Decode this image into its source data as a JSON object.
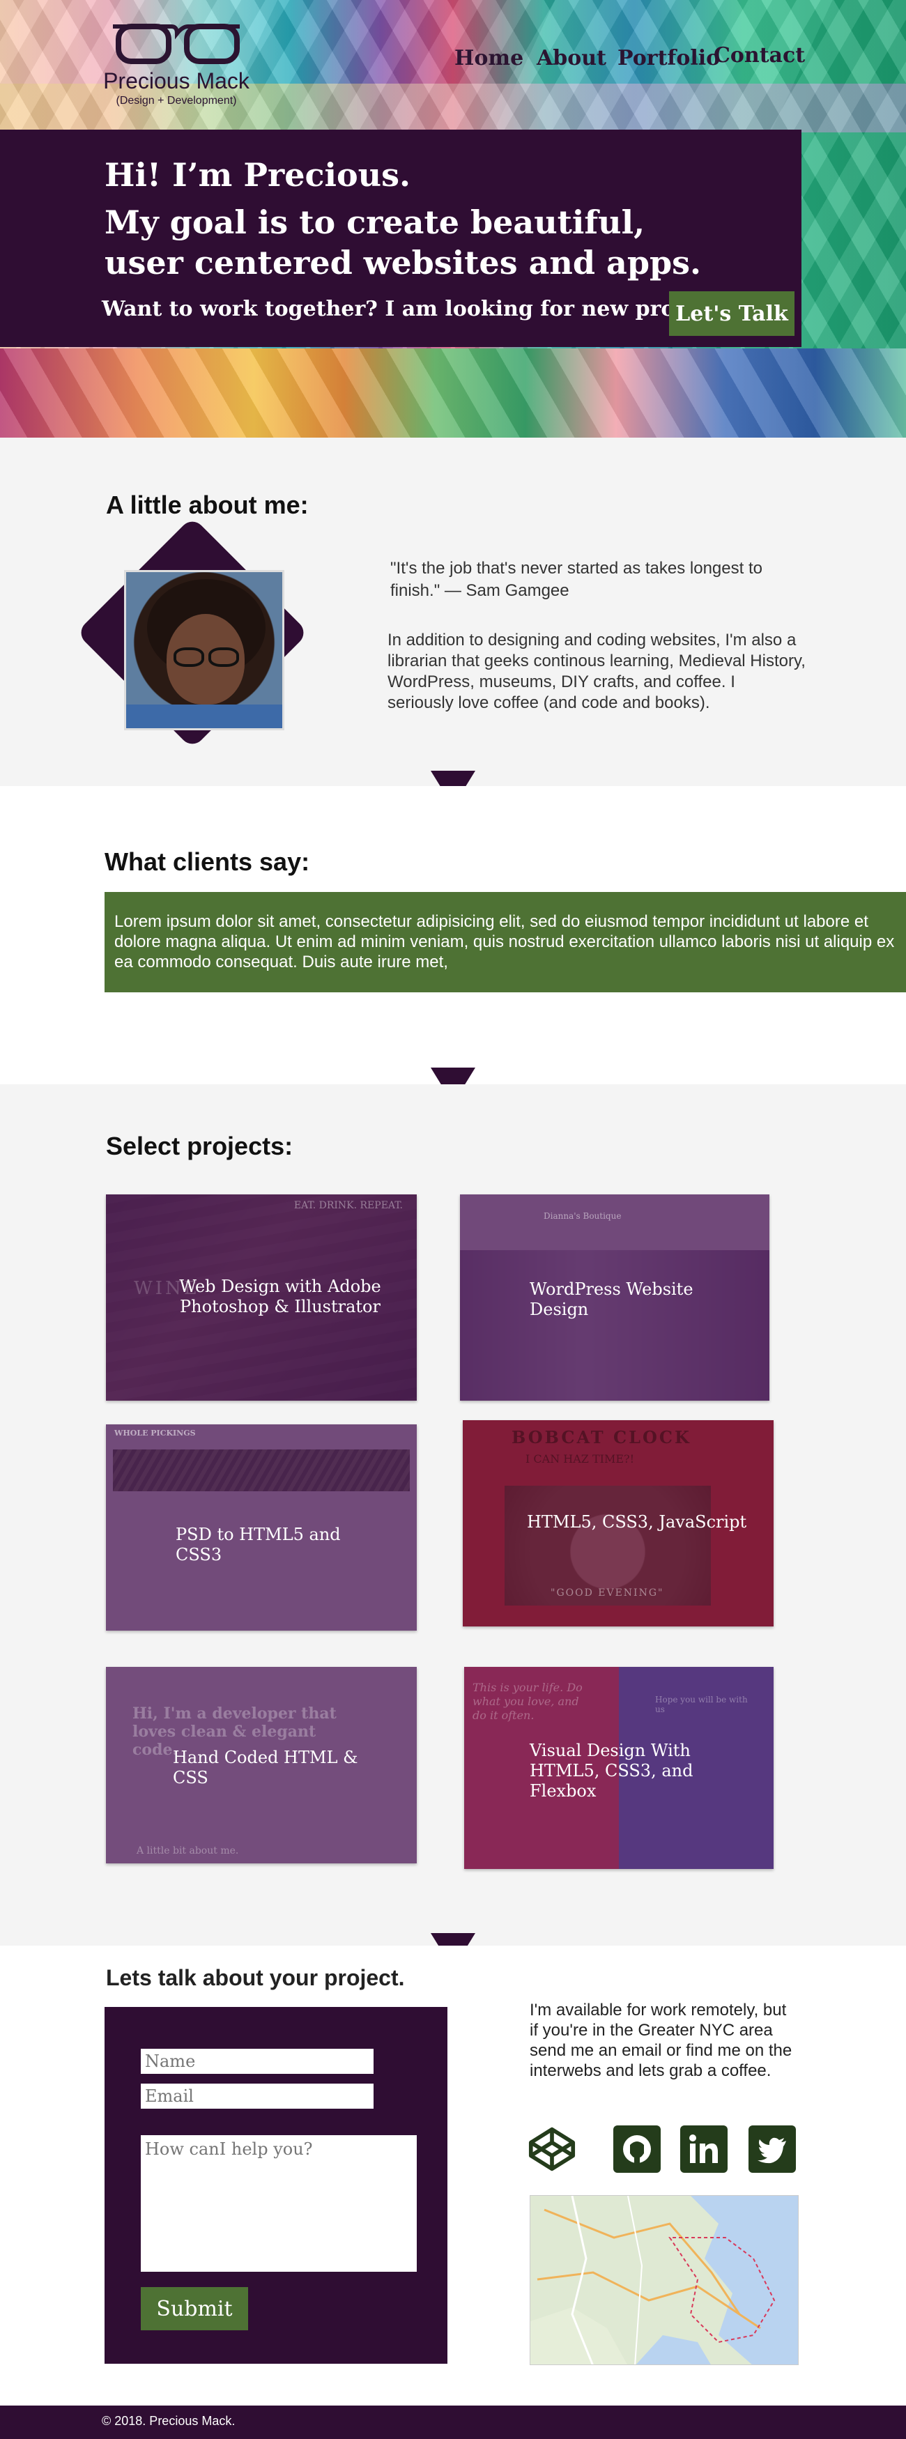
{
  "header": {
    "brand": "Precious Mack",
    "tagline": "(Design + Development)",
    "nav": [
      "Home",
      "About",
      "Portfolio",
      "Contact"
    ]
  },
  "hero": {
    "greeting": "Hi! I’m Precious.",
    "headline": "My goal is to create beautiful, user centered websites and apps.",
    "subline": "Want to work together? I am looking for new projects.",
    "cta": "Let's Talk"
  },
  "about": {
    "title": "A little about me:",
    "quote": "\"It's the job that's never started as takes longest to finish.\"  — Sam Gamgee",
    "bio": "In addition to designing and coding websites, I'm also a librarian that geeks continous learning, Medieval History, WordPress, museums, DIY crafts, and coffee. I seriously love coffee (and code and books)."
  },
  "clients": {
    "title": "What clients say:",
    "testimonial": "Lorem ipsum dolor sit amet, consectetur adipisicing elit, sed do eiusmod tempor incididunt ut labore et dolore magna aliqua. Ut enim ad minim veniam, quis nostrud exercitation ullamco laboris nisi ut aliquip ex ea commodo consequat. Duis aute irure met,"
  },
  "projects": {
    "title": "Select projects:",
    "items": [
      {
        "label": "Web Design with Adobe Photoshop & Illustrator"
      },
      {
        "label": "WordPress Website Design"
      },
      {
        "label": "PSD to HTML5 and CSS3"
      },
      {
        "label": "HTML5, CSS3, JavaScript"
      },
      {
        "label": "Hand Coded HTML & CSS"
      },
      {
        "label": "Visual Design With HTML5, CSS3, and Flexbox"
      }
    ],
    "screenshot_text": {
      "p1_top": "EAT. DRINK. REPEAT.",
      "p1_word": "WINE",
      "p2_brand": "Dianna's Boutique",
      "p3_brand": "WHOLE PICKINGS",
      "p4_title": "BOBCAT CLOCK",
      "p4_time": "I CAN HAZ TIME?!",
      "p4_greet": "\"GOOD EVENING\"",
      "p5_hi": "Hi, I'm a developer that loves clean & elegant code.",
      "p5_foot": "A little bit about me.",
      "p6_left": "This is your life. Do what you love, and do it often.",
      "p6_right": "Hope you will be with us"
    }
  },
  "contact": {
    "title": "Lets talk about your project.",
    "name_placeholder": "Name",
    "email_placeholder": "Email",
    "message_placeholder": "How canI help you?",
    "submit": "Submit",
    "availability": "I'm available for work remotely, but if you're in the Greater NYC area send me an email or find me on the interwebs and lets grab a coffee.",
    "social": [
      "codepen-icon",
      "github-icon",
      "linkedin-icon",
      "twitter-icon"
    ]
  },
  "footer": {
    "copyright": "© 2018. Precious Mack."
  },
  "colors": {
    "purple": "#2f0d33",
    "green": "#4e7234",
    "light_bg": "#f4f4f4"
  }
}
